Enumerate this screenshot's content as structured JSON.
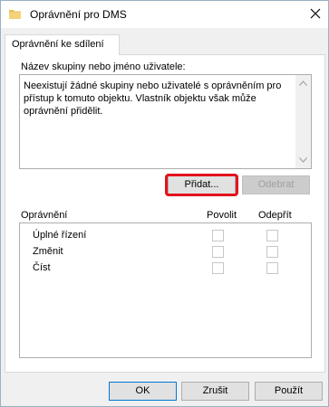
{
  "window": {
    "title": "Oprávnění pro DMS"
  },
  "tabs": [
    {
      "label": "Oprávnění ke sdílení"
    }
  ],
  "group_section": {
    "label": "Název skupiny nebo jméno uživatele:",
    "empty_message": "Neexistují žádné skupiny nebo uživatelé s oprávněním pro přístup k tomuto objektu. Vlastník objektu však může oprávnění přidělit."
  },
  "buttons": {
    "add": "Přidat...",
    "remove": "Odebrat",
    "ok": "OK",
    "cancel": "Zrušit",
    "apply": "Použít"
  },
  "permissions": {
    "header": "Oprávnění",
    "allow_header": "Povolit",
    "deny_header": "Odepřít",
    "rows": [
      {
        "name": "Úplné řízení",
        "allow": false,
        "deny": false
      },
      {
        "name": "Změnit",
        "allow": false,
        "deny": false
      },
      {
        "name": "Číst",
        "allow": false,
        "deny": false
      }
    ]
  },
  "icons": {
    "title_icon": "folder-icon",
    "close_icon": "close-icon"
  },
  "colors": {
    "highlight": "#e3121c",
    "folder": "#e8c15a"
  }
}
